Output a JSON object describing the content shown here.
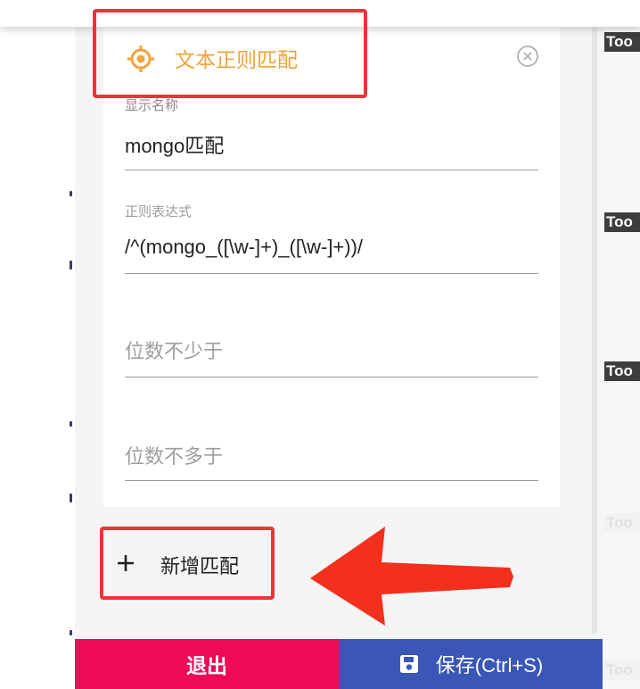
{
  "card": {
    "type_title": "文本正则匹配",
    "type_icon": "target-icon",
    "close_icon": "circle-close-icon"
  },
  "fields": {
    "display_name": {
      "label": "显示名称",
      "value": "mongo匹配"
    },
    "regex": {
      "label": "正则表达式",
      "value": "/^(mongo_([\\w-]+)_([\\w-]+))/"
    },
    "min_digits": {
      "placeholder": "位数不少于"
    },
    "max_digits": {
      "placeholder": "位数不多于"
    }
  },
  "add_match": {
    "icon": "plus-icon",
    "label": "新增匹配"
  },
  "footer": {
    "exit_label": "退出",
    "save_label": "保存(Ctrl+S)",
    "save_icon": "floppy-disk-icon"
  },
  "background": {
    "tool_tag_label": "Too"
  },
  "colors": {
    "accent_orange": "#f2a33a",
    "exit_red": "#ee0a58",
    "save_blue": "#3a56b7",
    "annotation_red": "#e8363a"
  }
}
